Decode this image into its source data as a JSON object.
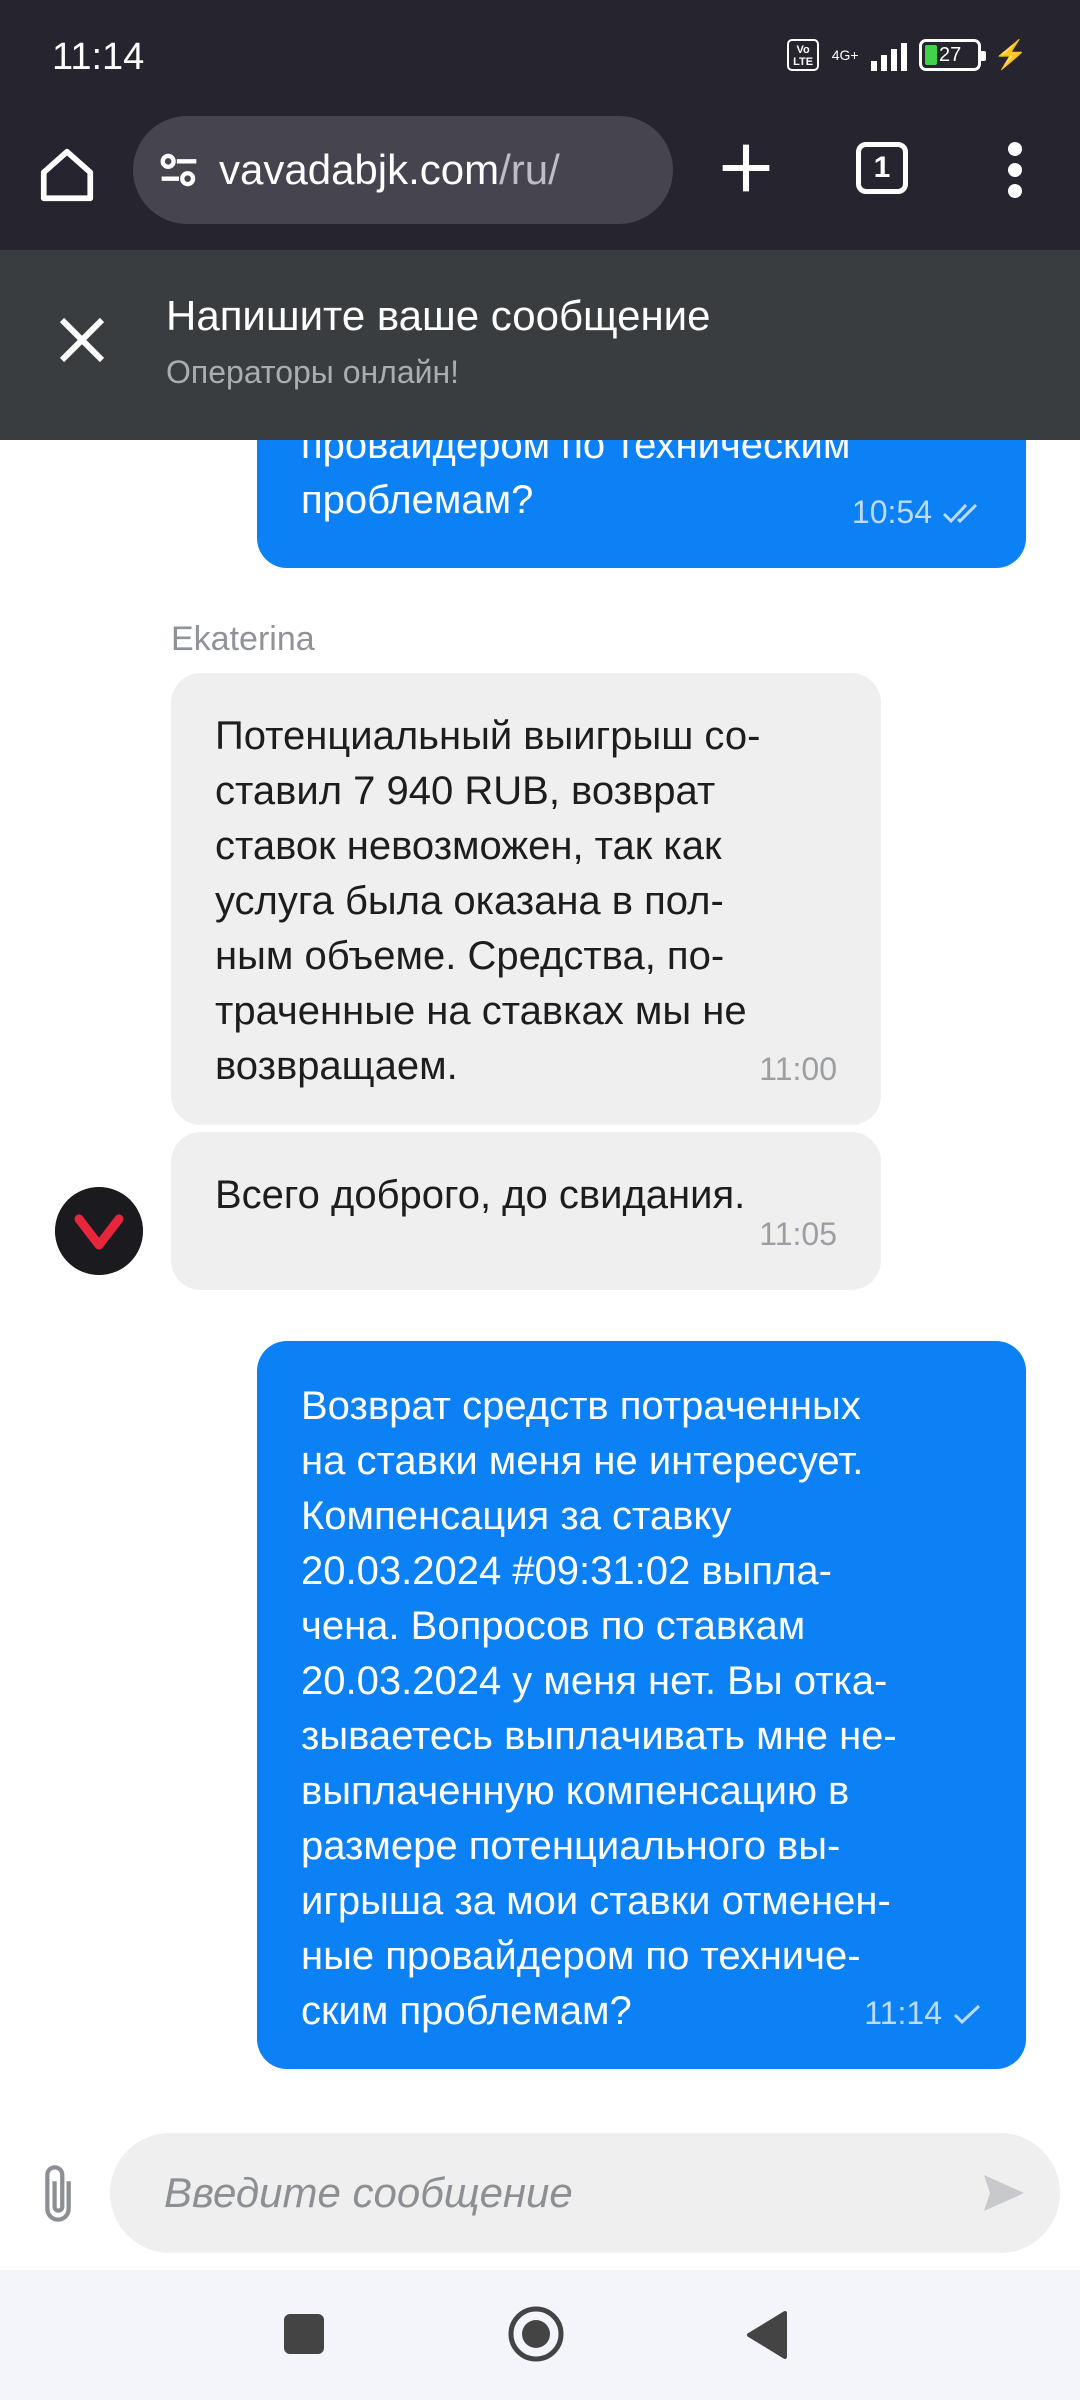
{
  "status_bar": {
    "time": "11:14",
    "volte": "Vo LTE",
    "network": "4G+",
    "battery": "27"
  },
  "browser": {
    "url_domain": "vavadabjk.com",
    "url_path": "/ru/",
    "tab_count": "1"
  },
  "chat_header": {
    "title": "Напишите ваше сообщение",
    "subtitle": "Операторы онлайн!"
  },
  "messages": [
    {
      "side": "out",
      "text": "провайдером по техническим\nпроблемам?",
      "time": "10:54",
      "status": "read"
    },
    {
      "side": "in",
      "sender": "Ekaterina",
      "text": "Потенциальный выигрыш со-\nставил 7 940 RUB, возврат\nставок невозможен, так как\nуслуга была оказана в пол-\nным объеме. Средства, по-\nтраченные на ставках мы не\nвозвращаем.",
      "time": "11:00"
    },
    {
      "side": "in",
      "text": "Всего доброго, до свидания.",
      "time": "11:05"
    },
    {
      "side": "out",
      "text": "Возврат средств потраченных\nна ставки меня не интересует.\nКомпенсация за ставку\n20.03.2024 #09:31:02 выпла-\nчена. Вопросов по ставкам\n20.03.2024 у меня нет. Вы отка-\nзываетесь выплачивать мне не-\nвыплаченную компенсацию в\nразмере потенциального вы-\nигрыша за мои ставки отменен-\nные провайдером по техниче-\nским проблемам?",
      "time": "11:14",
      "status": "sent"
    }
  ],
  "composer": {
    "placeholder": "Введите сообщение",
    "value": ""
  },
  "colors": {
    "outgoing_bubble": "#0c80f5",
    "incoming_bubble": "#efefef",
    "header_bg": "#3a3d40",
    "browser_bg": "#25242f",
    "brand_accent": "#e8263b"
  },
  "icons": [
    "home-icon",
    "site-settings-icon",
    "new-tab-icon",
    "tab-switcher-icon",
    "more-menu-icon",
    "close-icon",
    "attach-icon",
    "send-icon",
    "brand-logo-icon"
  ]
}
